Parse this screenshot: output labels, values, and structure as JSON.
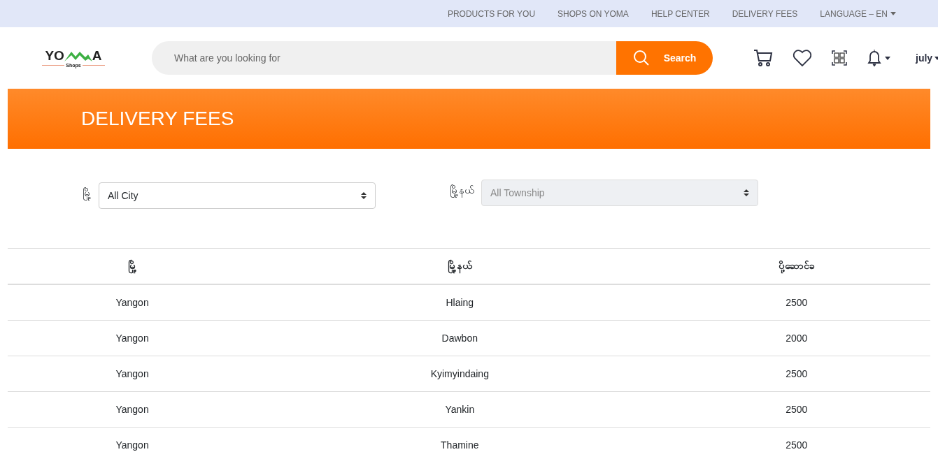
{
  "top_nav": {
    "links": [
      "PRODUCTS FOR YOU",
      "SHOPS ON YOMA",
      "HELP CENTER",
      "DELIVERY FEES"
    ],
    "language": "LANGUAGE – EN"
  },
  "header": {
    "logo": {
      "left": "YO",
      "right": "A",
      "sub": "Shops"
    },
    "search": {
      "placeholder": "What are you looking for",
      "button": "Search"
    },
    "user": "july"
  },
  "banner": {
    "title": "DELIVERY FEES"
  },
  "filters": [
    {
      "label": "မြို့",
      "value": "All City",
      "disabled": false
    },
    {
      "label": "မြို့နယ်",
      "value": "All Township",
      "disabled": true
    }
  ],
  "table": {
    "columns": [
      "မြို့",
      "မြို့နယ်",
      "ပို့ဆောင်ခ"
    ],
    "rows": [
      [
        "Yangon",
        "Hlaing",
        "2500"
      ],
      [
        "Yangon",
        "Dawbon",
        "2000"
      ],
      [
        "Yangon",
        "Kyimyindaing",
        "2500"
      ],
      [
        "Yangon",
        "Yankin",
        "2500"
      ],
      [
        "Yangon",
        "Thamine",
        "2500"
      ]
    ]
  }
}
